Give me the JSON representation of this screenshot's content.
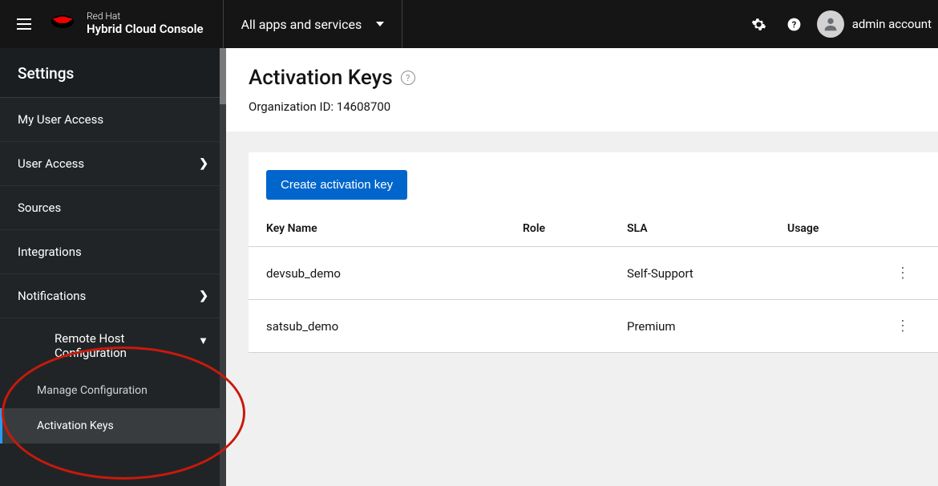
{
  "brand": {
    "sub": "Red Hat",
    "main": "Hybrid Cloud Console"
  },
  "apps_dropdown": "All apps and services",
  "account_name": "admin account",
  "sidebar": {
    "heading": "Settings",
    "items": [
      {
        "label": "My User Access",
        "chevron": false
      },
      {
        "label": "User Access",
        "chevron": true
      },
      {
        "label": "Sources",
        "chevron": false
      },
      {
        "label": "Integrations",
        "chevron": false
      },
      {
        "label": "Notifications",
        "chevron": true
      }
    ],
    "rhc": {
      "label": "Remote Host Configuration",
      "children": [
        {
          "label": "Manage Configuration",
          "active": false
        },
        {
          "label": "Activation Keys",
          "active": true
        }
      ]
    }
  },
  "page": {
    "title": "Activation Keys",
    "org_label": "Organization ID:",
    "org_id": "14608700",
    "create_btn": "Create activation key"
  },
  "table": {
    "headers": {
      "name": "Key Name",
      "role": "Role",
      "sla": "SLA",
      "usage": "Usage"
    },
    "rows": [
      {
        "name": "devsub_demo",
        "role": "",
        "sla": "Self-Support",
        "usage": ""
      },
      {
        "name": "satsub_demo",
        "role": "",
        "sla": "Premium",
        "usage": ""
      }
    ]
  }
}
